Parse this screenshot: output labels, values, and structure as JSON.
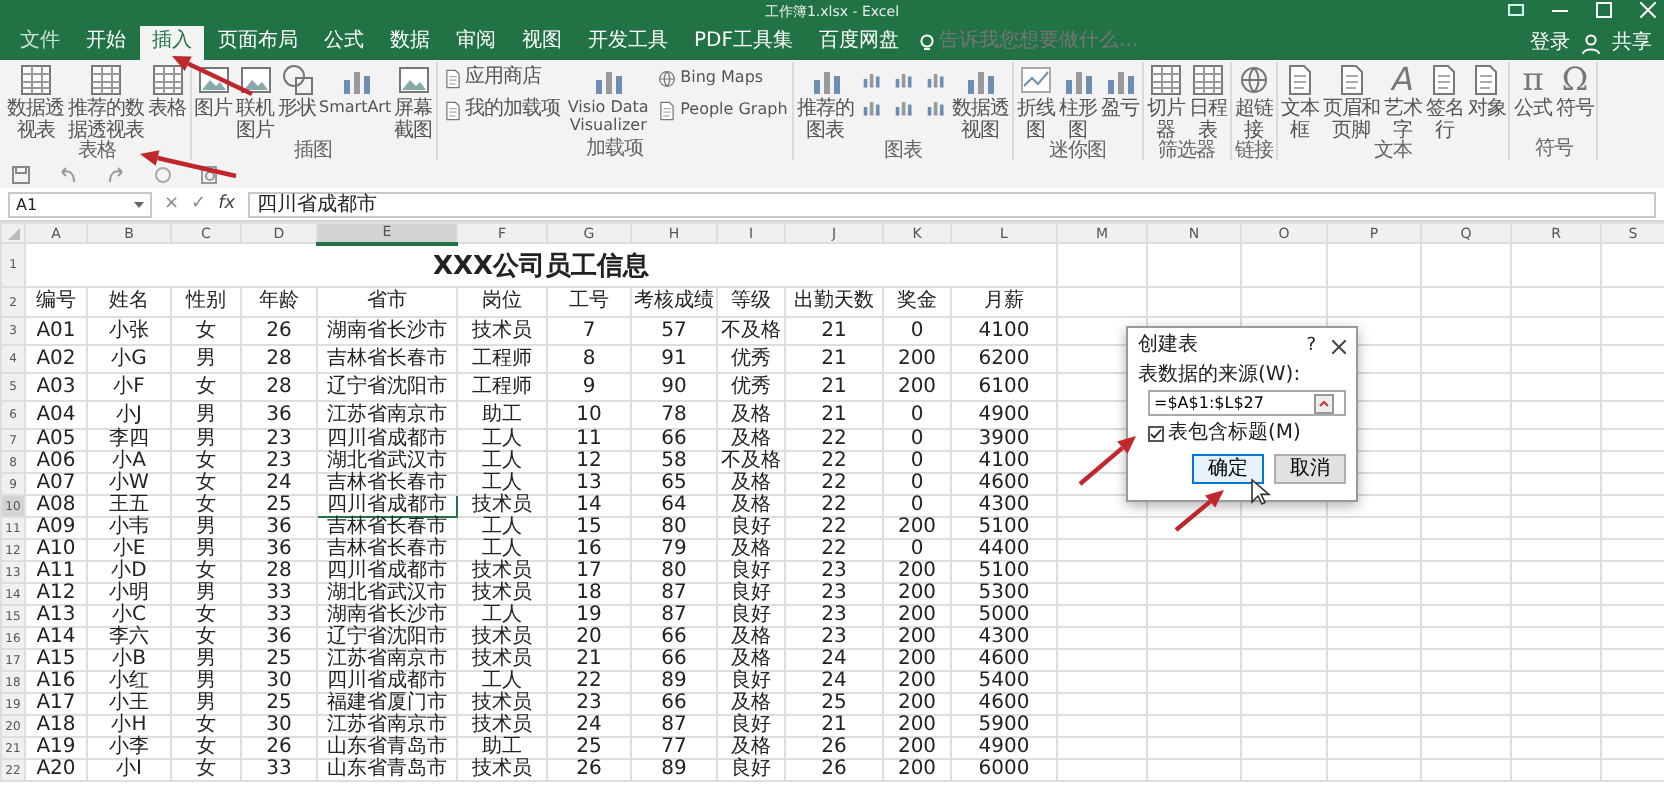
{
  "window": {
    "title": "工作簿1.xlsx - Excel"
  },
  "tabs": [
    {
      "label": "文件",
      "selected": false
    },
    {
      "label": "开始",
      "selected": false
    },
    {
      "label": "插入",
      "selected": true
    },
    {
      "label": "页面布局",
      "selected": false
    },
    {
      "label": "公式",
      "selected": false
    },
    {
      "label": "数据",
      "selected": false
    },
    {
      "label": "审阅",
      "selected": false
    },
    {
      "label": "视图",
      "selected": false
    },
    {
      "label": "开发工具",
      "selected": false
    },
    {
      "label": "PDF工具集",
      "selected": false
    },
    {
      "label": "百度网盘",
      "selected": false
    }
  ],
  "search": {
    "placeholder": "告诉我您想要做什么..."
  },
  "account": {
    "sign_in": "登录",
    "share": "共享"
  },
  "ribbon": {
    "groups": [
      {
        "label": "表格",
        "buttons": [
          {
            "label": "数据透视表",
            "kind": "large"
          },
          {
            "label": "推荐的数据透视表",
            "kind": "large"
          },
          {
            "label": "表格",
            "kind": "large"
          }
        ]
      },
      {
        "label": "插图",
        "buttons": [
          {
            "label": "图片",
            "kind": "large"
          },
          {
            "label": "联机图片",
            "kind": "large"
          },
          {
            "label": "形状",
            "kind": "large"
          },
          {
            "label": "SmartArt",
            "kind": "large"
          },
          {
            "label": "屏幕截图",
            "kind": "large"
          }
        ]
      },
      {
        "label": "加载项",
        "buttons": [
          {
            "label": "应用商店",
            "kind": "small"
          },
          {
            "label": "我的加载项",
            "kind": "small"
          },
          {
            "label": "Visio Data Visualizer",
            "kind": "large"
          },
          {
            "label": "Bing Maps",
            "kind": "small"
          },
          {
            "label": "People Graph",
            "kind": "small"
          }
        ]
      },
      {
        "label": "图表",
        "buttons": [
          {
            "label": "推荐的图表",
            "kind": "large"
          },
          {
            "kind": "icon"
          },
          {
            "kind": "icon"
          },
          {
            "kind": "icon"
          },
          {
            "kind": "icon"
          },
          {
            "kind": "icon"
          },
          {
            "kind": "icon"
          },
          {
            "label": "数据透视图",
            "kind": "large"
          }
        ]
      },
      {
        "label": "迷你图",
        "buttons": [
          {
            "label": "折线图",
            "kind": "large"
          },
          {
            "label": "柱形图",
            "kind": "large"
          },
          {
            "label": "盈亏",
            "kind": "large"
          }
        ]
      },
      {
        "label": "筛选器",
        "buttons": [
          {
            "label": "切片器",
            "kind": "large"
          },
          {
            "label": "日程表",
            "kind": "large"
          }
        ]
      },
      {
        "label": "链接",
        "buttons": [
          {
            "label": "超链接",
            "kind": "large"
          }
        ]
      },
      {
        "label": "文本",
        "buttons": [
          {
            "label": "文本框",
            "kind": "large"
          },
          {
            "label": "页眉和页脚",
            "kind": "large"
          },
          {
            "label": "艺术字",
            "kind": "large",
            "glyph": "A"
          },
          {
            "label": "签名行",
            "kind": "large"
          },
          {
            "label": "对象",
            "kind": "large"
          }
        ]
      },
      {
        "label": "符号",
        "buttons": [
          {
            "label": "公式",
            "kind": "large",
            "glyph": "π"
          },
          {
            "label": "符号",
            "kind": "large",
            "glyph": "Ω"
          }
        ]
      }
    ]
  },
  "formula_bar": {
    "name_box": "A1",
    "cancel": "×",
    "enter": "✓",
    "function": "fx",
    "value": "四川省成都市"
  },
  "sheet": {
    "columns": [
      {
        "label": "A",
        "selected": false
      },
      {
        "label": "B",
        "selected": false
      },
      {
        "label": "C",
        "selected": false
      },
      {
        "label": "D",
        "selected": false
      },
      {
        "label": "E",
        "selected": true
      },
      {
        "label": "F",
        "selected": false
      },
      {
        "label": "G",
        "selected": false
      },
      {
        "label": "H",
        "selected": false
      },
      {
        "label": "I",
        "selected": false
      },
      {
        "label": "J",
        "selected": false
      },
      {
        "label": "K",
        "selected": false
      },
      {
        "label": "L",
        "selected": false
      },
      {
        "label": "M",
        "selected": false
      },
      {
        "label": "N",
        "selected": false
      },
      {
        "label": "O",
        "selected": false
      },
      {
        "label": "P",
        "selected": false
      },
      {
        "label": "Q",
        "selected": false
      },
      {
        "label": "R",
        "selected": false
      },
      {
        "label": "S",
        "selected": false
      }
    ],
    "title_row": {
      "number": "1",
      "selected": false,
      "title": "XXX公司员工信息"
    },
    "rows": [
      {
        "number": "2",
        "kind": "header",
        "selected": false,
        "cells": [
          "编号",
          "姓名",
          "性别",
          "年龄",
          "省市",
          "岗位",
          "工号",
          "考核成绩",
          "等级",
          "出勤天数",
          "奖金",
          "月薪"
        ]
      },
      {
        "number": "3",
        "kind": "data",
        "selected": false,
        "cells": [
          "A01",
          "小张",
          "女",
          "26",
          "湖南省长沙市",
          "技术员",
          "7",
          "57",
          "不及格",
          "21",
          "0",
          "4100"
        ]
      },
      {
        "number": "4",
        "kind": "data",
        "selected": false,
        "cells": [
          "A02",
          "小G",
          "男",
          "28",
          "吉林省长春市",
          "工程师",
          "8",
          "91",
          "优秀",
          "21",
          "200",
          "6200"
        ]
      },
      {
        "number": "5",
        "kind": "data",
        "selected": false,
        "cells": [
          "A03",
          "小F",
          "女",
          "28",
          "辽宁省沈阳市",
          "工程师",
          "9",
          "90",
          "优秀",
          "21",
          "200",
          "6100"
        ]
      },
      {
        "number": "6",
        "kind": "data",
        "selected": false,
        "cells": [
          "A04",
          "小J",
          "男",
          "36",
          "江苏省南京市",
          "助工",
          "10",
          "78",
          "及格",
          "21",
          "0",
          "4900"
        ]
      },
      {
        "number": "7",
        "kind": "data",
        "selected": false,
        "cells": [
          "A05",
          "李四",
          "男",
          "23",
          "四川省成都市",
          "工人",
          "11",
          "66",
          "及格",
          "22",
          "0",
          "3900"
        ]
      },
      {
        "number": "8",
        "kind": "data",
        "selected": false,
        "cells": [
          "A06",
          "小A",
          "女",
          "23",
          "湖北省武汉市",
          "工人",
          "12",
          "58",
          "不及格",
          "22",
          "0",
          "4100"
        ]
      },
      {
        "number": "9",
        "kind": "data",
        "selected": false,
        "cells": [
          "A07",
          "小W",
          "女",
          "24",
          "吉林省长春市",
          "工人",
          "13",
          "65",
          "及格",
          "22",
          "0",
          "4600"
        ]
      },
      {
        "number": "10",
        "kind": "data",
        "selected": true,
        "cells": [
          "A08",
          "王五",
          "女",
          "25",
          "四川省成都市",
          "技术员",
          "14",
          "64",
          "及格",
          "22",
          "0",
          "4300"
        ]
      },
      {
        "number": "11",
        "kind": "data",
        "selected": false,
        "cells": [
          "A09",
          "小韦",
          "男",
          "36",
          "吉林省长春市",
          "工人",
          "15",
          "80",
          "良好",
          "22",
          "200",
          "5100"
        ]
      },
      {
        "number": "12",
        "kind": "data",
        "selected": false,
        "cells": [
          "A10",
          "小E",
          "男",
          "36",
          "吉林省长春市",
          "工人",
          "16",
          "79",
          "及格",
          "22",
          "0",
          "4400"
        ]
      },
      {
        "number": "13",
        "kind": "data",
        "selected": false,
        "cells": [
          "A11",
          "小D",
          "女",
          "28",
          "四川省成都市",
          "技术员",
          "17",
          "80",
          "良好",
          "23",
          "200",
          "5100"
        ]
      },
      {
        "number": "14",
        "kind": "data",
        "selected": false,
        "cells": [
          "A12",
          "小明",
          "男",
          "33",
          "湖北省武汉市",
          "技术员",
          "18",
          "87",
          "良好",
          "23",
          "200",
          "5300"
        ]
      },
      {
        "number": "15",
        "kind": "data",
        "selected": false,
        "cells": [
          "A13",
          "小C",
          "女",
          "33",
          "湖南省长沙市",
          "工人",
          "19",
          "87",
          "良好",
          "23",
          "200",
          "5000"
        ]
      },
      {
        "number": "16",
        "kind": "data",
        "selected": false,
        "cells": [
          "A14",
          "李六",
          "女",
          "36",
          "辽宁省沈阳市",
          "技术员",
          "20",
          "66",
          "及格",
          "23",
          "200",
          "4300"
        ]
      },
      {
        "number": "17",
        "kind": "data",
        "selected": false,
        "cells": [
          "A15",
          "小B",
          "男",
          "25",
          "江苏省南京市",
          "技术员",
          "21",
          "66",
          "及格",
          "24",
          "200",
          "4600"
        ]
      },
      {
        "number": "18",
        "kind": "data",
        "selected": false,
        "cells": [
          "A16",
          "小红",
          "男",
          "30",
          "四川省成都市",
          "工人",
          "22",
          "89",
          "良好",
          "24",
          "200",
          "5400"
        ]
      },
      {
        "number": "19",
        "kind": "data",
        "selected": false,
        "cells": [
          "A17",
          "小王",
          "男",
          "25",
          "福建省厦门市",
          "技术员",
          "23",
          "66",
          "及格",
          "25",
          "200",
          "4600"
        ]
      },
      {
        "number": "20",
        "kind": "data",
        "selected": false,
        "cells": [
          "A18",
          "小H",
          "女",
          "30",
          "江苏省南京市",
          "技术员",
          "24",
          "87",
          "良好",
          "21",
          "200",
          "5900"
        ]
      },
      {
        "number": "21",
        "kind": "data",
        "selected": false,
        "cells": [
          "A19",
          "小李",
          "女",
          "26",
          "山东省青岛市",
          "助工",
          "25",
          "77",
          "及格",
          "26",
          "200",
          "4900"
        ]
      },
      {
        "number": "22",
        "kind": "data",
        "selected": false,
        "cells": [
          "A20",
          "小I",
          "女",
          "33",
          "山东省青岛市",
          "技术员",
          "26",
          "89",
          "良好",
          "26",
          "200",
          "6000"
        ]
      }
    ]
  },
  "dialog": {
    "title": "创建表",
    "help": "?",
    "source_label": "表数据的来源(W):",
    "source_value": "=$A$1:$L$27",
    "has_headers": {
      "label": "表包含标题(M)",
      "checked": true
    },
    "buttons": [
      {
        "label": "确定",
        "default": true
      },
      {
        "label": "取消",
        "default": false
      }
    ]
  }
}
